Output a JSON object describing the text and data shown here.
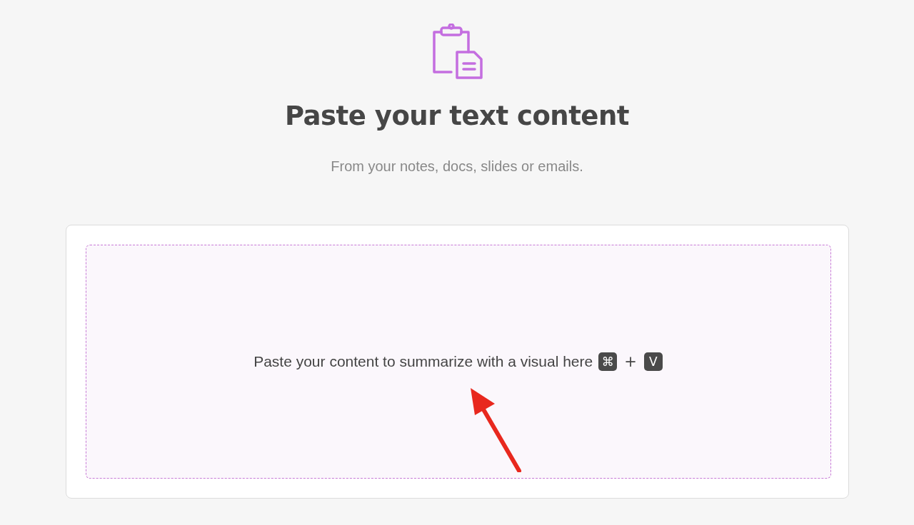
{
  "header": {
    "title": "Paste your text content",
    "subtitle": "From your notes, docs, slides or emails."
  },
  "paste_area": {
    "prompt": "Paste your content to summarize with a visual here",
    "shortcut": [
      {
        "kind": "key",
        "text": "⌘"
      },
      {
        "kind": "plus",
        "text": "+"
      },
      {
        "kind": "key",
        "text": "V"
      }
    ]
  }
}
